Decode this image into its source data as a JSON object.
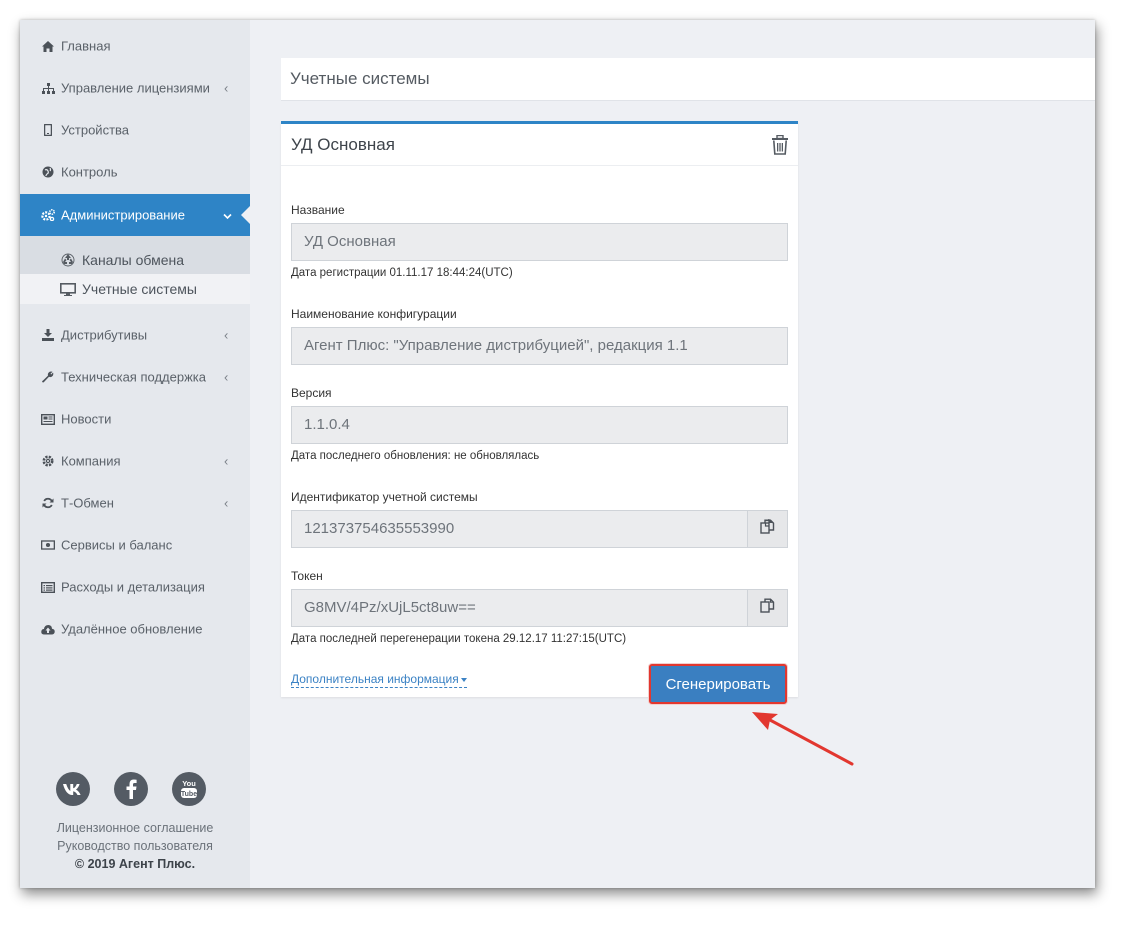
{
  "sidebar": {
    "items": [
      {
        "label": "Главная",
        "icon": "home-icon",
        "has_submenu": false
      },
      {
        "label": "Управление лицензиями",
        "icon": "sitemap-icon",
        "has_submenu": true
      },
      {
        "label": "Устройства",
        "icon": "mobile-icon",
        "has_submenu": false
      },
      {
        "label": "Контроль",
        "icon": "globe-icon",
        "has_submenu": false
      },
      {
        "label": "Администрирование",
        "icon": "cogs-icon",
        "has_submenu": true,
        "active": true
      },
      {
        "label": "Дистрибутивы",
        "icon": "download-icon",
        "has_submenu": true
      },
      {
        "label": "Техническая поддержка",
        "icon": "wrench-icon",
        "has_submenu": true
      },
      {
        "label": "Новости",
        "icon": "newspaper-icon",
        "has_submenu": false
      },
      {
        "label": "Компания",
        "icon": "gear-icon",
        "has_submenu": true
      },
      {
        "label": "Т-Обмен",
        "icon": "refresh-icon",
        "has_submenu": true
      },
      {
        "label": "Сервисы и баланс",
        "icon": "money-icon",
        "has_submenu": false
      },
      {
        "label": "Расходы и детализация",
        "icon": "list-alt-icon",
        "has_submenu": false
      },
      {
        "label": "Удалённое обновление",
        "icon": "cloud-upload-icon",
        "has_submenu": false
      }
    ],
    "submenu": [
      {
        "label": "Каналы обмена",
        "icon": "recycle-icon"
      },
      {
        "label": "Учетные системы",
        "icon": "desktop-icon",
        "current": true
      }
    ],
    "social": [
      "vk-icon",
      "facebook-icon",
      "youtube-icon"
    ],
    "footer": {
      "license": "Лицензионное соглашение",
      "manual": "Руководство пользователя",
      "copyright": "© 2019 Агент Плюс."
    }
  },
  "page": {
    "title": "Учетные системы"
  },
  "card": {
    "title": "УД Основная",
    "fields": {
      "name_label": "Название",
      "name_value": "УД Основная",
      "reg_date": "Дата регистрации 01.11.17 18:44:24(UTC)",
      "config_label": "Наименование конфигурации",
      "config_value": "Агент Плюс: \"Управление дистрибуцией\", редакция 1.1",
      "version_label": "Версия",
      "version_value": "1.1.0.4",
      "update_date": "Дата последнего обновления: не обновлялась",
      "id_label": "Идентификатор учетной системы",
      "id_value": "121373754635553990",
      "token_label": "Токен",
      "token_value": "G8MV/4Pz/xUjL5ct8uw==",
      "token_date": "Дата последней перегенерации токена 29.12.17 11:27:15(UTC)"
    },
    "more_link": "Дополнительная информация",
    "generate_button": "Сгенерировать"
  },
  "colors": {
    "accent": "#2e84c6",
    "button": "#3a7fc1",
    "highlight": "#e2372f"
  }
}
